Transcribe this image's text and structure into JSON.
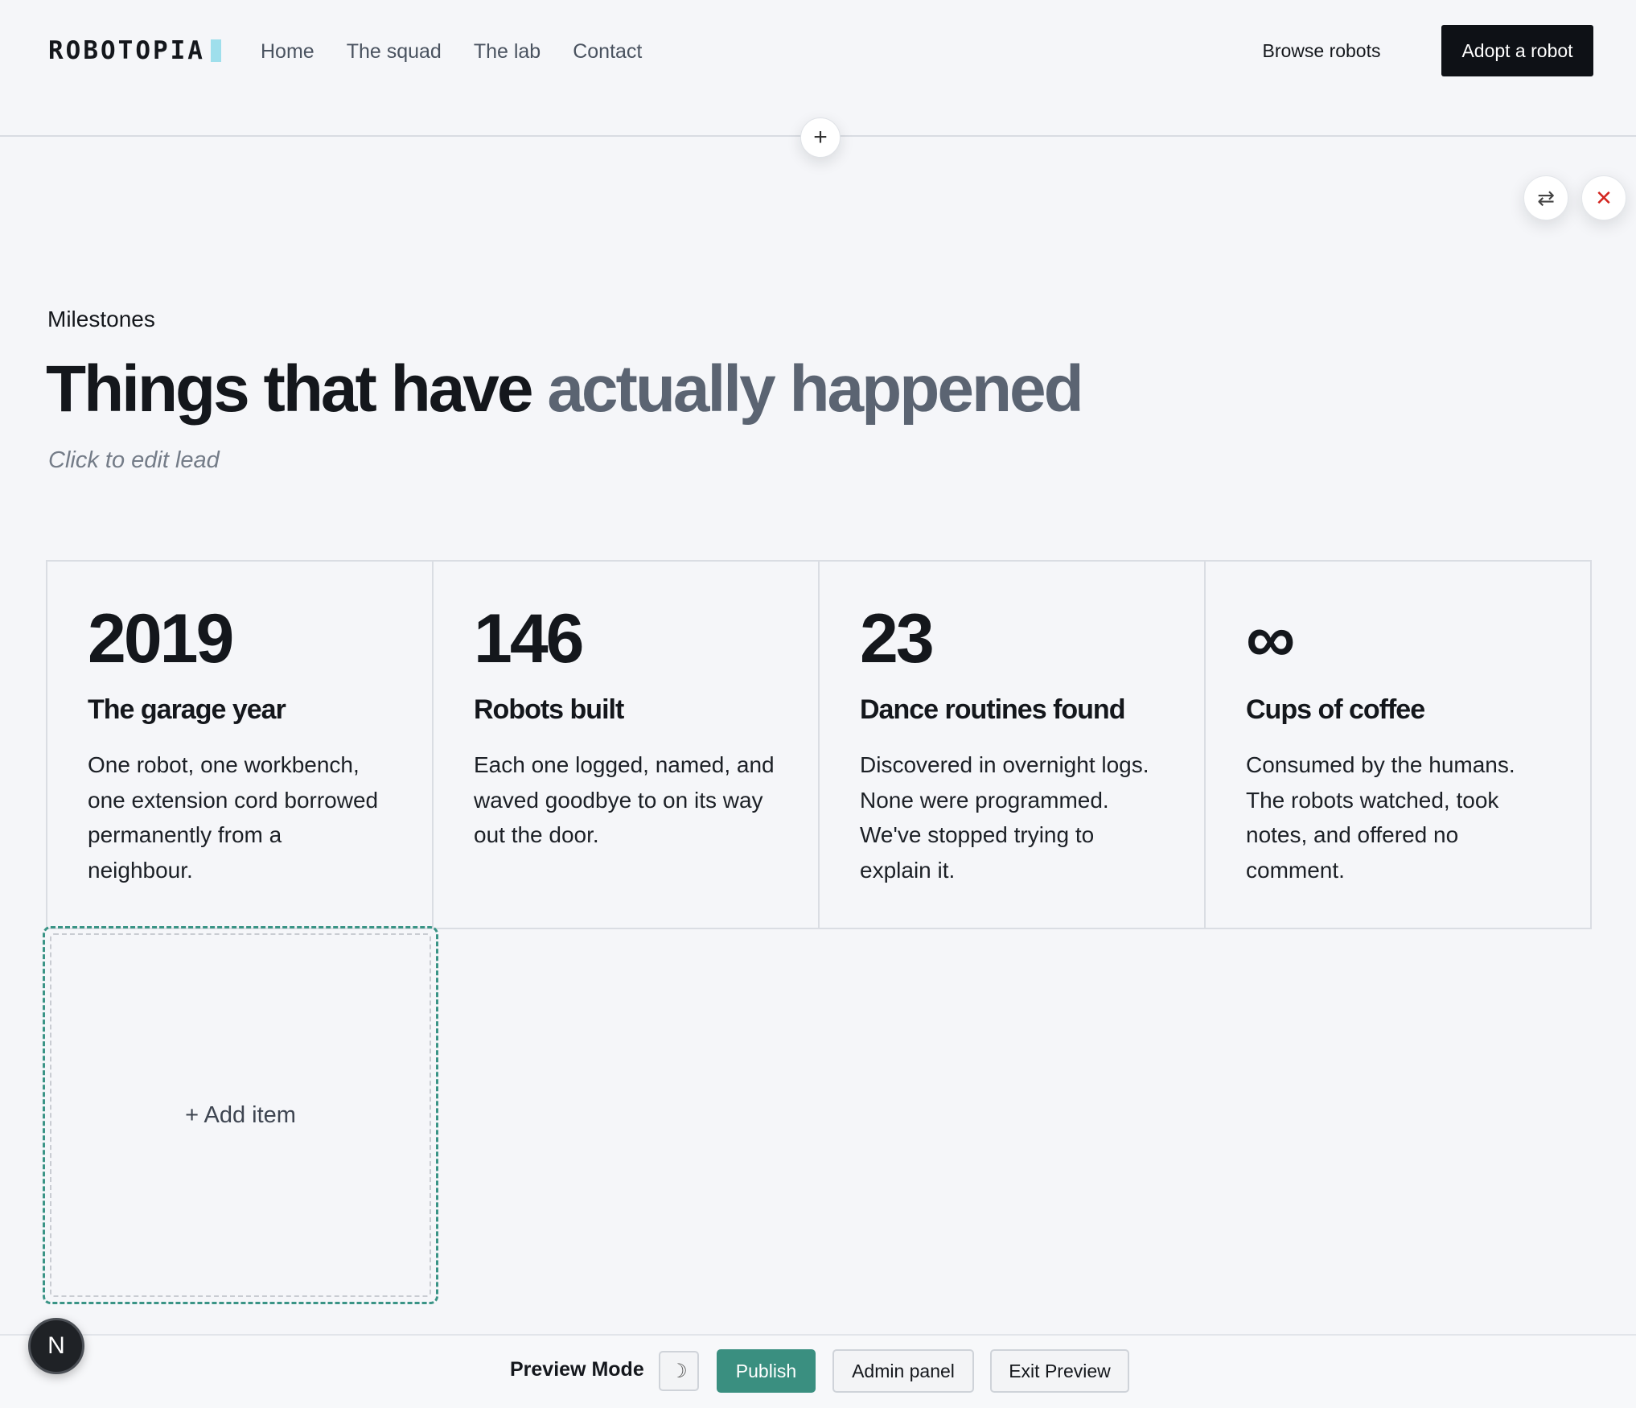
{
  "brand": {
    "logo_text": "ROBOTOPIA"
  },
  "nav": {
    "items": [
      {
        "label": "Home"
      },
      {
        "label": "The squad"
      },
      {
        "label": "The lab"
      },
      {
        "label": "Contact"
      }
    ]
  },
  "header_actions": {
    "browse_label": "Browse robots",
    "adopt_label": "Adopt a robot"
  },
  "section_tools": {
    "add_section_icon": "plus-icon",
    "swap_icon": "swap-arrows-icon",
    "close_icon": "close-icon",
    "close_color": "#d3251f"
  },
  "milestones": {
    "eyebrow": "Milestones",
    "title_main": "Things that have ",
    "title_accent": "actually happened",
    "lead_placeholder": "Click to edit lead",
    "items": [
      {
        "value": "2019",
        "label": "The garage year",
        "description": "One robot, one workbench, one extension cord borrowed permanently from a neighbour."
      },
      {
        "value": "146",
        "label": "Robots built",
        "description": "Each one logged, named, and waved goodbye to on its way out the door."
      },
      {
        "value": "23",
        "label": "Dance routines found",
        "description": "Discovered in overnight logs. None were programmed. We've stopped trying to explain it."
      },
      {
        "value": "∞",
        "label": "Cups of coffee",
        "description": "Consumed by the humans. The robots watched, took notes, and offered no comment."
      }
    ],
    "add_item_label": "+ Add item"
  },
  "bottom_bar": {
    "mode_label": "Preview Mode",
    "theme_toggle_icon": "moon-icon",
    "publish_label": "Publish",
    "admin_label": "Admin panel",
    "exit_label": "Exit Preview",
    "publish_color": "#3a8f80"
  },
  "avatar": {
    "initial": "N"
  }
}
